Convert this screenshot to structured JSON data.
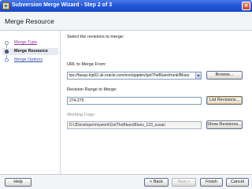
{
  "window": {
    "title": "Subversion Merge Wizard - Step 2 of 3",
    "close_glyph": "×"
  },
  "header": {
    "title": "Merge Resource"
  },
  "sidebar": {
    "steps": [
      {
        "label": "Merge Type",
        "state": "visited"
      },
      {
        "label": "Merge Resource",
        "state": "current"
      },
      {
        "label": "Merge Options",
        "state": "pending"
      }
    ]
  },
  "main": {
    "instruction": "Select the revisions to merge:",
    "url_label": "URL to Merge From:",
    "url_value": "tps://faxup-tvp02.uk.oracle.com/svn/appdev/gotTheBlues/trunk/Blues",
    "browse_button": "Browse...",
    "revision_label": "Revision Range to Merge:",
    "revision_value": "274-275",
    "list_revisions_button": "List Revisions...",
    "working_copy_label": "Working Copy:",
    "working_copy_value": "D:\\JDeveloper\\mywork\\GotTheBlues\\Blues_123_susan",
    "show_revisions_button": "Show Revisions..."
  },
  "footer": {
    "help": "Help",
    "back": "< Back",
    "next": "Next >",
    "finish": "Finish",
    "cancel": "Cancel"
  },
  "colors": {
    "titlebar": "#2458d8",
    "visited_link": "#8a3a9a",
    "pending_link": "#3a4fb0",
    "field_border": "#7f9db9"
  }
}
